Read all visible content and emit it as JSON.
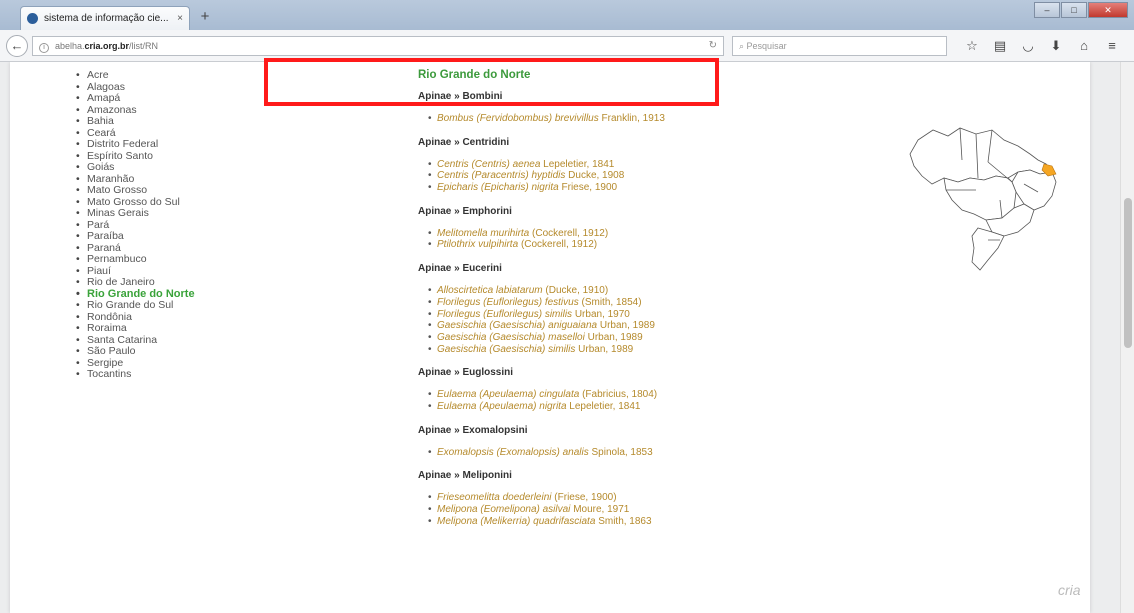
{
  "browser": {
    "tab_title": "sistema de informação cie...",
    "tab_close": "×",
    "new_tab": "+",
    "url_prefix": "abelha.",
    "url_domain": "cria.org.br",
    "url_path": "/list/RN",
    "search_placeholder": "Pesquisar"
  },
  "states": [
    "Acre",
    "Alagoas",
    "Amapá",
    "Amazonas",
    "Bahia",
    "Ceará",
    "Distrito Federal",
    "Espírito Santo",
    "Goiás",
    "Maranhão",
    "Mato Grosso",
    "Mato Grosso do Sul",
    "Minas Gerais",
    "Pará",
    "Paraíba",
    "Paraná",
    "Pernambuco",
    "Piauí",
    "Rio de Janeiro",
    "Rio Grande do Norte",
    "Rio Grande do Sul",
    "Rondônia",
    "Roraima",
    "Santa Catarina",
    "São Paulo",
    "Sergipe",
    "Tocantins"
  ],
  "active_state": "Rio Grande do Norte",
  "content": {
    "state_title": "Rio Grande do Norte",
    "tribes": [
      {
        "name": "Apinae » Bombini",
        "species": [
          {
            "name": "Bombus (Fervidobombus) brevivillus",
            "author": "Franklin, 1913"
          }
        ]
      },
      {
        "name": "Apinae » Centridini",
        "species": [
          {
            "name": "Centris (Centris) aenea",
            "author": "Lepeletier, 1841"
          },
          {
            "name": "Centris (Paracentris) hyptidis",
            "author": "Ducke, 1908"
          },
          {
            "name": "Epicharis (Epicharis) nigrita",
            "author": "Friese, 1900"
          }
        ]
      },
      {
        "name": "Apinae » Emphorini",
        "species": [
          {
            "name": "Melitomella murihirta",
            "author": "(Cockerell, 1912)"
          },
          {
            "name": "Ptilothrix vulpihirta",
            "author": "(Cockerell, 1912)"
          }
        ]
      },
      {
        "name": "Apinae » Eucerini",
        "species": [
          {
            "name": "Alloscirtetica labiatarum",
            "author": "(Ducke, 1910)"
          },
          {
            "name": "Florilegus (Euflorilegus) festivus",
            "author": "(Smith, 1854)"
          },
          {
            "name": "Florilegus (Euflorilegus) similis",
            "author": "Urban, 1970"
          },
          {
            "name": "Gaesischia (Gaesischia) aniguaiana",
            "author": "Urban, 1989"
          },
          {
            "name": "Gaesischia (Gaesischia) maselloi",
            "author": "Urban, 1989"
          },
          {
            "name": "Gaesischia (Gaesischia) similis",
            "author": "Urban, 1989"
          }
        ]
      },
      {
        "name": "Apinae » Euglossini",
        "species": [
          {
            "name": "Eulaema (Apeulaema) cingulata",
            "author": "(Fabricius, 1804)"
          },
          {
            "name": "Eulaema (Apeulaema) nigrita",
            "author": "Lepeletier, 1841"
          }
        ]
      },
      {
        "name": "Apinae » Exomalopsini",
        "species": [
          {
            "name": "Exomalopsis (Exomalopsis) analis",
            "author": "Spinola, 1853"
          }
        ]
      },
      {
        "name": "Apinae » Meliponini",
        "species": [
          {
            "name": "Frieseomelitta doederleini",
            "author": "(Friese, 1900)"
          },
          {
            "name": "Melipona (Eomelipona) asilvai",
            "author": "Moure, 1971"
          },
          {
            "name": "Melipona (Melikerria) quadrifasciata",
            "author": "Smith, 1863"
          }
        ]
      }
    ]
  },
  "colors": {
    "active_state": "#3aa33a",
    "species_text": "#b58a2c",
    "highlight": "#ff1a1a",
    "map_highlight": "#f5a623"
  },
  "watermark": "cria"
}
